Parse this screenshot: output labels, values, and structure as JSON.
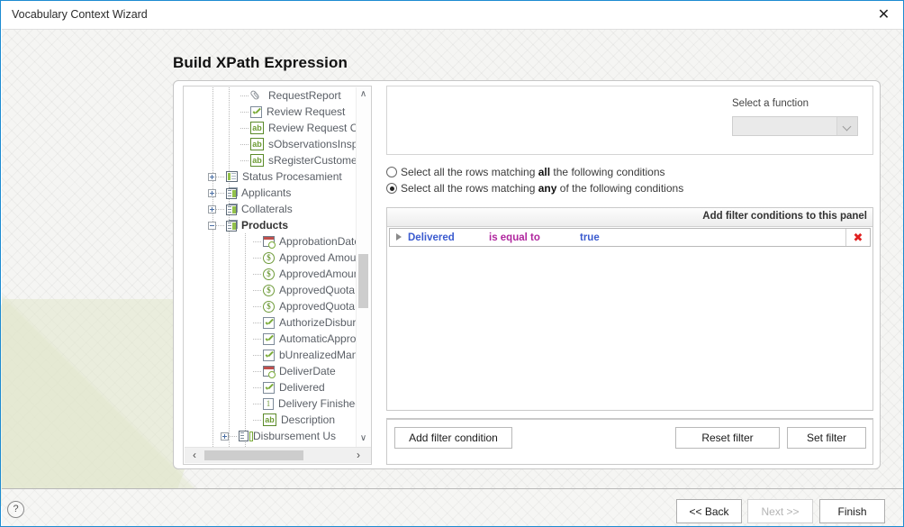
{
  "window": {
    "title": "Vocabulary Context Wizard",
    "close_icon": "close-icon",
    "close_glyph": "✕"
  },
  "page": {
    "heading": "Build XPath Expression"
  },
  "tree": {
    "vscroll_up_glyph": "∧",
    "vscroll_down_glyph": "∨",
    "hscroll_left_glyph": "‹",
    "hscroll_right_glyph": "›",
    "items": [
      {
        "label": "RequestReport",
        "icon": "paperclip-icon",
        "icon_class": "ic-clip",
        "indent": 62,
        "expander": "none",
        "bold": false
      },
      {
        "label": "Review Request",
        "icon": "boolean-checkbox-icon",
        "icon_class": "ic-check",
        "indent": 62,
        "expander": "none",
        "bold": false
      },
      {
        "label": "Review Request Com",
        "icon": "text-ab-icon",
        "icon_class": "ic-ab",
        "indent": 62,
        "expander": "none",
        "bold": false
      },
      {
        "label": "sObservationsInspec",
        "icon": "text-ab-icon",
        "icon_class": "ic-ab",
        "indent": 62,
        "expander": "none",
        "bold": false
      },
      {
        "label": "sRegisterCustomer",
        "icon": "text-ab-icon",
        "icon_class": "ic-ab",
        "indent": 62,
        "expander": "none",
        "bold": false
      },
      {
        "label": "Status Procesamient",
        "icon": "status-list-icon",
        "icon_class": "ic-status",
        "indent": 44,
        "expander": "plus",
        "bold": false
      },
      {
        "label": "Applicants",
        "icon": "entity-table-icon",
        "icon_class": "ic-table ic-table2",
        "indent": 44,
        "expander": "plus",
        "bold": false
      },
      {
        "label": "Collaterals",
        "icon": "entity-table-icon",
        "icon_class": "ic-table ic-table2",
        "indent": 44,
        "expander": "plus",
        "bold": false
      },
      {
        "label": "Products",
        "icon": "entity-table-icon",
        "icon_class": "ic-table ic-table2",
        "indent": 44,
        "expander": "minus",
        "bold": true
      },
      {
        "label": "ApprobationDate",
        "icon": "date-icon",
        "icon_class": "ic-date",
        "indent": 76,
        "expander": "none",
        "bold": false
      },
      {
        "label": "Approved Amoun",
        "icon": "money-icon",
        "icon_class": "ic-money",
        "indent": 76,
        "expander": "none",
        "bold": false
      },
      {
        "label": "ApprovedAmount",
        "icon": "money-icon",
        "icon_class": "ic-money",
        "indent": 76,
        "expander": "none",
        "bold": false
      },
      {
        "label": "ApprovedQuota",
        "icon": "money-icon",
        "icon_class": "ic-money",
        "indent": 76,
        "expander": "none",
        "bold": false
      },
      {
        "label": "ApprovedQuotaL",
        "icon": "money-icon",
        "icon_class": "ic-money",
        "indent": 76,
        "expander": "none",
        "bold": false
      },
      {
        "label": "AuthorizeDisburs",
        "icon": "boolean-checkbox-icon",
        "icon_class": "ic-check",
        "indent": 76,
        "expander": "none",
        "bold": false
      },
      {
        "label": "AutomaticApprov",
        "icon": "boolean-checkbox-icon",
        "icon_class": "ic-check",
        "indent": 76,
        "expander": "none",
        "bold": false
      },
      {
        "label": "bUnrealizedMana",
        "icon": "boolean-checkbox-icon",
        "icon_class": "ic-check",
        "indent": 76,
        "expander": "none",
        "bold": false
      },
      {
        "label": "DeliverDate",
        "icon": "date-icon",
        "icon_class": "ic-date",
        "indent": 76,
        "expander": "none",
        "bold": false
      },
      {
        "label": "Delivered",
        "icon": "boolean-checkbox-icon",
        "icon_class": "ic-check",
        "indent": 76,
        "expander": "none",
        "bold": false
      },
      {
        "label": "Delivery Finished",
        "icon": "numeric-icon",
        "icon_class": "ic-num",
        "indent": 76,
        "expander": "none",
        "bold": false
      },
      {
        "label": "Description",
        "icon": "text-ab-icon",
        "icon_class": "ic-ab",
        "indent": 76,
        "expander": "none",
        "bold": false
      },
      {
        "label": "Disbursement Us",
        "icon": "entity-column-icon",
        "icon_class": "ic-ent",
        "indent": 58,
        "expander": "plus",
        "bold": false
      }
    ]
  },
  "function_panel": {
    "label": "Select a function",
    "selected_value": "",
    "dropdown_icon": "chevron-down-icon"
  },
  "match_options": {
    "all": {
      "prefix": "Select all the rows matching ",
      "emphasis": "all",
      "suffix": " the following conditions",
      "selected": false
    },
    "any": {
      "prefix": "Select all the rows matching ",
      "emphasis": "any",
      "suffix": " of the following conditions",
      "selected": true
    }
  },
  "filter_grid": {
    "header": "Add filter conditions to this panel",
    "columns": [
      "field",
      "operator",
      "value"
    ],
    "rows": [
      {
        "field": "Delivered",
        "operator": "is equal to",
        "value": "true",
        "delete_glyph": "✖"
      }
    ]
  },
  "filter_actions": {
    "add": "Add filter condition",
    "reset": "Reset  filter",
    "set": "Set  filter"
  },
  "wizard_footer": {
    "help_glyph": "?",
    "back": "<< Back",
    "next": "Next >>",
    "finish": "Finish",
    "next_enabled": false
  },
  "colors": {
    "window_border": "#1d8bd1",
    "field_text": "#3b5bcf",
    "operator_text": "#b0269e",
    "value_text": "#3b5bcf",
    "delete_icon": "#e02020",
    "icon_green": "#7aab38"
  }
}
